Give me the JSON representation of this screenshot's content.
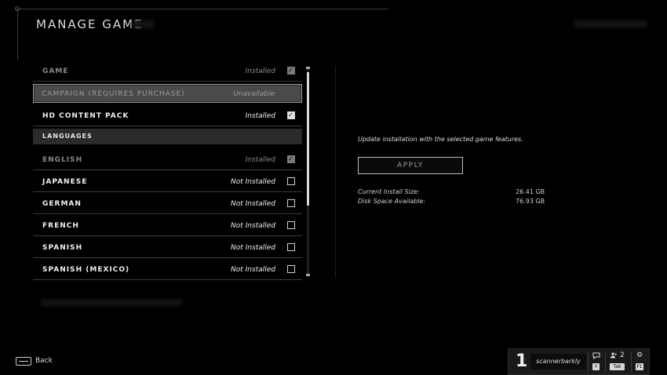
{
  "title": "MANAGE GAME",
  "list": {
    "rows": [
      {
        "label": "GAME",
        "status": "Installed",
        "checked": true
      },
      {
        "label": "CAMPAIGN (REQUIRES PURCHASE)",
        "status": "Unavailable"
      },
      {
        "label": "HD CONTENT PACK",
        "status": "Installed",
        "checked": true
      },
      {
        "label": "LANGUAGES"
      },
      {
        "label": "ENGLISH",
        "status": "Installed",
        "checked": true
      },
      {
        "label": "JAPANESE",
        "status": "Not Installed",
        "checked": false
      },
      {
        "label": "GERMAN",
        "status": "Not Installed",
        "checked": false
      },
      {
        "label": "FRENCH",
        "status": "Not Installed",
        "checked": false
      },
      {
        "label": "SPANISH",
        "status": "Not Installed",
        "checked": false
      },
      {
        "label": "SPANISH (MEXICO)",
        "status": "Not Installed",
        "checked": false
      }
    ]
  },
  "panel": {
    "description": "Update installation with the selected game features.",
    "apply_label": "APPLY",
    "install_size_label": "Current Install Size:",
    "install_size_value": "26.41 GB",
    "disk_space_label": "Disk Space Available:",
    "disk_space_value": "76.93 GB"
  },
  "footer": {
    "back_label": "Back",
    "player_number": "1",
    "username": "scannerbarkly",
    "chat_key": "Y",
    "friends_count": "2",
    "friends_key": "Tab",
    "settings_key": "F1"
  },
  "icons": {
    "check": "checkmark-icon",
    "back": "back-key-icon",
    "chat": "chat-icon",
    "friends": "friends-icon",
    "settings": "gear-icon"
  }
}
